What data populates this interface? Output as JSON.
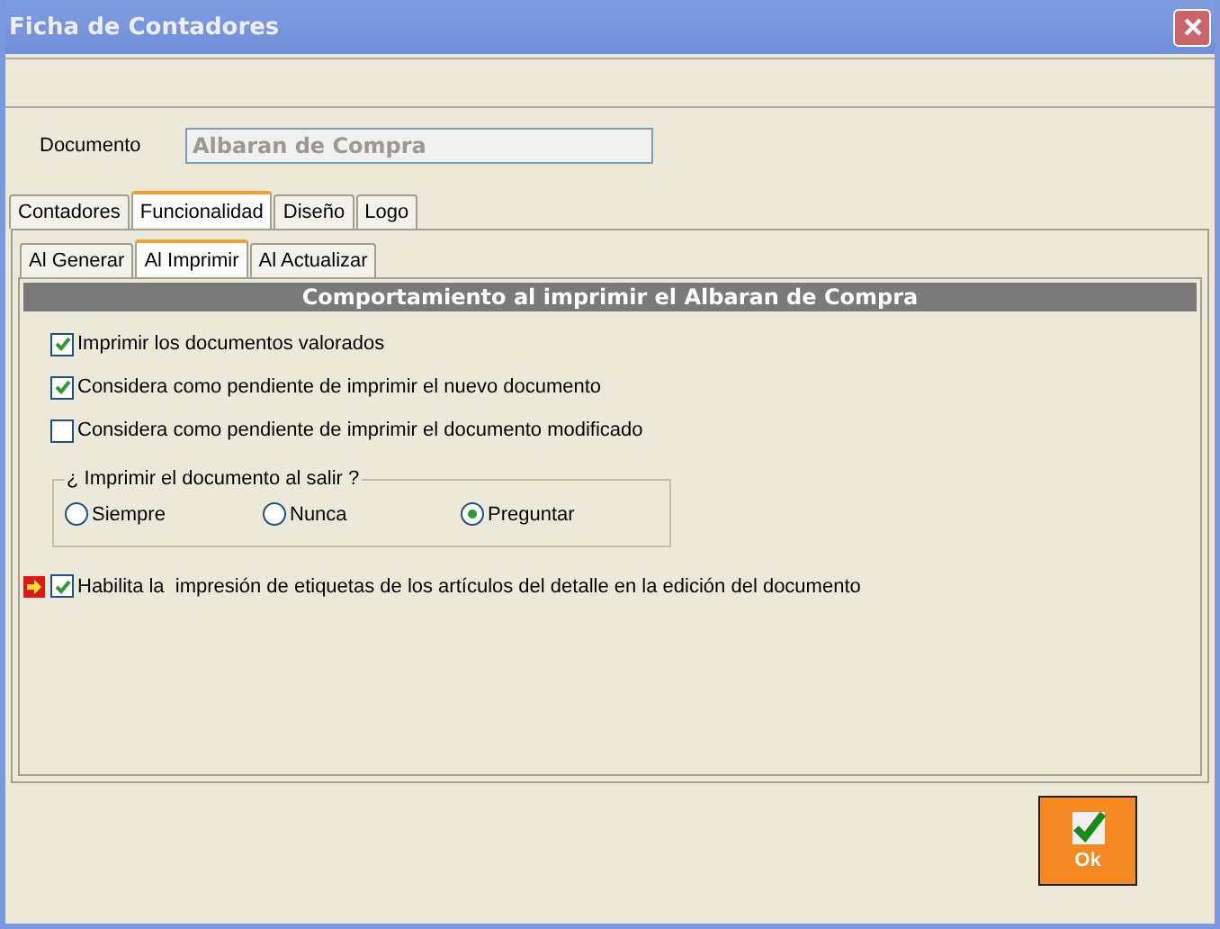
{
  "window": {
    "title": "Ficha de Contadores"
  },
  "document": {
    "label": "Documento",
    "value": "Albaran de Compra"
  },
  "tabs": [
    {
      "label": "Contadores",
      "selected": false
    },
    {
      "label": "Funcionalidad",
      "selected": true
    },
    {
      "label": "Diseño",
      "selected": false
    },
    {
      "label": "Logo",
      "selected": false
    }
  ],
  "subtabs": [
    {
      "label": "Al Generar",
      "selected": false
    },
    {
      "label": "Al Imprimir",
      "selected": true
    },
    {
      "label": "Al Actualizar",
      "selected": false
    }
  ],
  "section_title": "Comportamiento al imprimir el Albaran de Compra",
  "options": [
    {
      "label": "Imprimir los documentos valorados",
      "checked": true
    },
    {
      "label": "Considera como pendiente de imprimir el nuevo documento",
      "checked": true
    },
    {
      "label": "Considera como pendiente de imprimir el documento modificado",
      "checked": false
    }
  ],
  "print_on_exit": {
    "legend": "¿ Imprimir el documento al salir ?",
    "choices": [
      {
        "label": "Siempre",
        "selected": false
      },
      {
        "label": "Nunca",
        "selected": false
      },
      {
        "label": "Preguntar",
        "selected": true
      }
    ]
  },
  "label_printing": {
    "label": "Habilita la  impresión de etiquetas de los artículos del detalle en la edición del documento",
    "checked": true,
    "flagged": true
  },
  "ok_button": {
    "label": "Ok"
  }
}
